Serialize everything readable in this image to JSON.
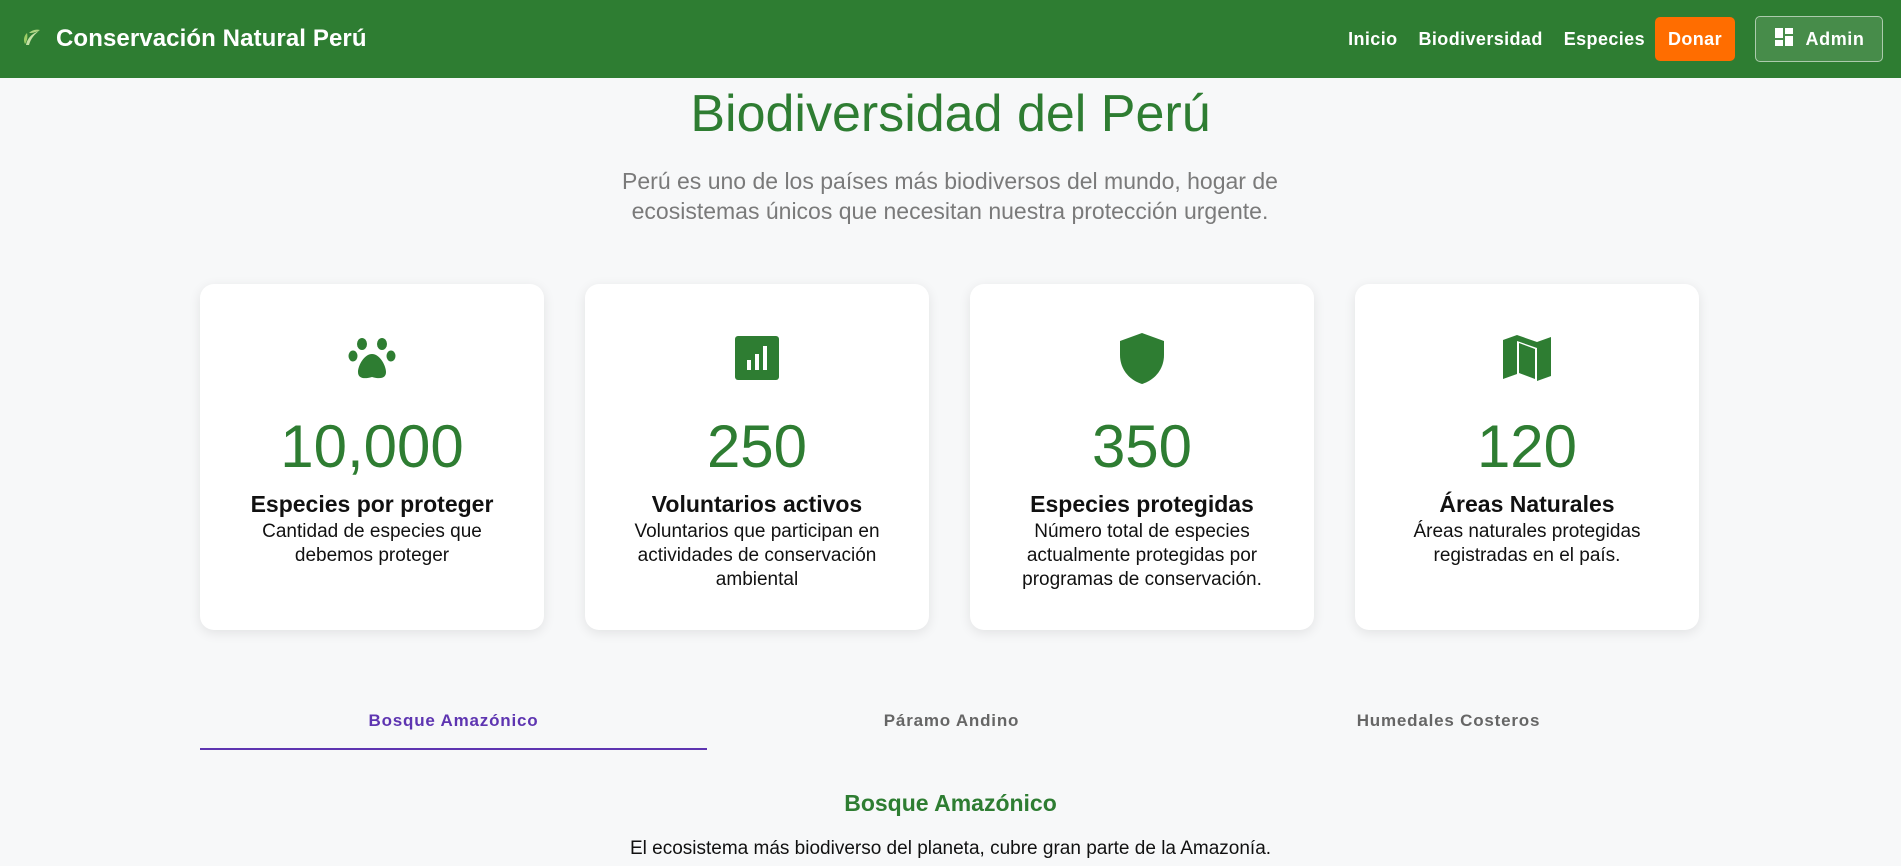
{
  "header": {
    "brand": "Conservación Natural Perú",
    "brand_icon": "leaf-icon",
    "nav": [
      "Inicio",
      "Biodiversidad",
      "Especies"
    ],
    "donate_label": "Donar",
    "admin_label": "Admin",
    "admin_icon": "dashboard-icon",
    "colors": {
      "bar": "#2e7d32",
      "donate": "#ff6d00"
    }
  },
  "hero": {
    "title": "Biodiversidad del Perú",
    "subtitle": "Perú es uno de los países más biodiversos del mundo, hogar de ecosistemas únicos que necesitan nuestra protección urgente."
  },
  "stats": [
    {
      "icon": "paw-icon",
      "value": "10,000",
      "title": "Especies por proteger",
      "desc": "Cantidad de especies que debemos proteger"
    },
    {
      "icon": "chart-icon",
      "value": "250",
      "title": "Voluntarios activos",
      "desc": "Voluntarios que participan en actividades de conservación ambiental"
    },
    {
      "icon": "shield-icon",
      "value": "350",
      "title": "Especies protegidas",
      "desc": "Número total de especies actualmente protegidas por programas de conservación."
    },
    {
      "icon": "map-icon",
      "value": "120",
      "title": "Áreas Naturales",
      "desc": "Áreas naturales protegidas registradas en el país."
    }
  ],
  "tabs": [
    {
      "label": "Bosque Amazónico",
      "active": true
    },
    {
      "label": "Páramo Andino",
      "active": false
    },
    {
      "label": "Humedales Costeros",
      "active": false
    }
  ],
  "section": {
    "title": "Bosque Amazónico",
    "desc": "El ecosistema más biodiverso del planeta, cubre gran parte de la Amazonía."
  }
}
